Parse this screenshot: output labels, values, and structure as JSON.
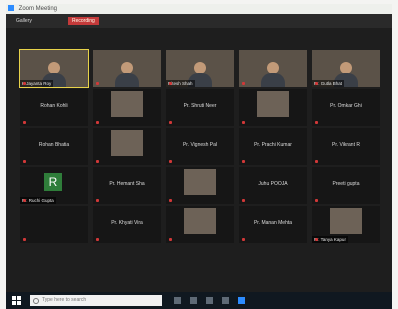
{
  "window": {
    "title": "Zoom Meeting"
  },
  "topbar": {
    "view_label": "Gallery",
    "record_label": "Recording"
  },
  "tiles": [
    {
      "name": "K Jayanta Roy",
      "type": "video",
      "speaking": true
    },
    {
      "name": "",
      "type": "video"
    },
    {
      "name": "Ritesh Shah",
      "type": "video"
    },
    {
      "name": "",
      "type": "video"
    },
    {
      "name": "Pr. Gutla Bhat",
      "type": "video"
    },
    {
      "name": "Rohan Kohli",
      "type": "name"
    },
    {
      "name": "",
      "type": "photo"
    },
    {
      "name": "Pr. Shruti Neer",
      "type": "name"
    },
    {
      "name": "",
      "type": "photo"
    },
    {
      "name": "Pr. Omkar Ghi",
      "type": "name"
    },
    {
      "name": "Rohan Bhatia",
      "type": "name"
    },
    {
      "name": "",
      "type": "photo"
    },
    {
      "name": "Pr. Vignesh Pal",
      "type": "name"
    },
    {
      "name": "Pr. Prachi Kumar",
      "type": "name"
    },
    {
      "name": "Pr. Vikrant R",
      "type": "name"
    },
    {
      "name": "Pr. Ruchi Gupta",
      "type": "avatar",
      "initial": "R"
    },
    {
      "name": "Pr. Hemant Sha",
      "type": "name"
    },
    {
      "name": "",
      "type": "photo"
    },
    {
      "name": "Juhu POOJA",
      "type": "name"
    },
    {
      "name": "Preeti gupta",
      "type": "name"
    },
    {
      "name": "",
      "type": "blank"
    },
    {
      "name": "Pr. Khyati Vira",
      "type": "name"
    },
    {
      "name": "",
      "type": "photo"
    },
    {
      "name": "Pr. Manan Mehta",
      "type": "name"
    },
    {
      "name": "Pr. Tanya Kapur",
      "type": "photo"
    }
  ],
  "taskbar": {
    "search_placeholder": "Type here to search"
  }
}
